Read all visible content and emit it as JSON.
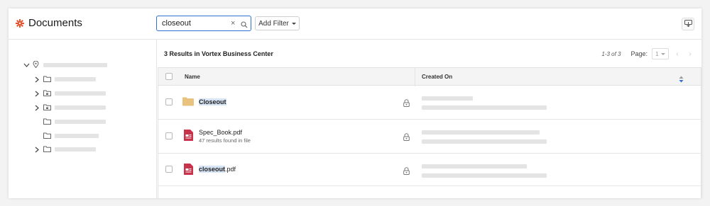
{
  "app": {
    "title": "Documents"
  },
  "search": {
    "value": "closeout",
    "clear_symbol": "×"
  },
  "filter": {
    "label": "Add Filter"
  },
  "results": {
    "title": "3 Results in Vortex Business Center"
  },
  "pager": {
    "range": "1-3 of 3",
    "page_label": "Page:",
    "page_value": "1",
    "prev": "‹",
    "next": "›"
  },
  "table": {
    "columns": [
      "Name",
      "Created On"
    ],
    "rows": [
      {
        "name_highlight": "Closeout",
        "name_rest": "",
        "subtext": "",
        "type": "folder"
      },
      {
        "name_highlight": "",
        "name_rest": "Spec_Book.pdf",
        "subtext": "47 results found in file",
        "type": "pdf"
      },
      {
        "name_highlight": "closeout",
        "name_rest": ".pdf",
        "subtext": "",
        "type": "pdf"
      }
    ]
  },
  "colors": {
    "accent": "#e8512a",
    "highlight": "#d6e4f5",
    "pdf": "#c7334a",
    "folder": "#e9c27e",
    "search_border": "#2f6fd6"
  }
}
